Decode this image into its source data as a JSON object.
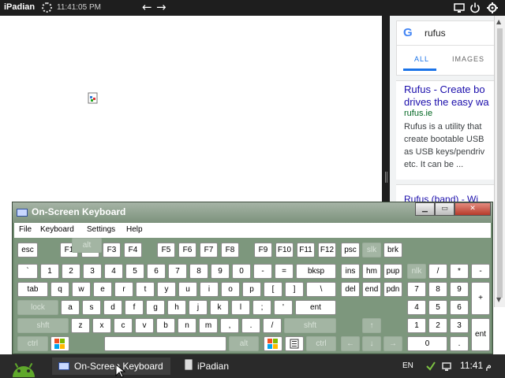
{
  "topbar": {
    "brand": "iPadian",
    "time": "11:41:05 PM",
    "back_glyph": "←",
    "forward_glyph": "→",
    "icons": [
      "monitor-icon",
      "power-icon",
      "settings-icon"
    ]
  },
  "google": {
    "logo": "G",
    "query": "rufus",
    "tabs": [
      "ALL",
      "IMAGES"
    ],
    "result1": {
      "title_line1": "Rufus - Create bo",
      "title_line2": "drives the easy wa",
      "url": "rufus.ie",
      "snippet": [
        "Rufus is a utility that",
        "create bootable USB",
        "as USB keys/pendriv",
        "etc. It can be ..."
      ]
    },
    "result2_title": "Rufus (band) - Wi"
  },
  "osk": {
    "title": "On-Screen Keyboard",
    "window_buttons": [
      "minimize",
      "maximize",
      "close"
    ],
    "menu": [
      "File",
      "Keyboard",
      "Settings",
      "Help"
    ],
    "row1": [
      "esc",
      "F1",
      "F2",
      "F3",
      "F4",
      "F5",
      "F6",
      "F7",
      "F8",
      "F9",
      "F10",
      "F11",
      "F12",
      "psc",
      "slk",
      "brk"
    ],
    "row2": [
      "`",
      "1",
      "2",
      "3",
      "4",
      "5",
      "6",
      "7",
      "8",
      "9",
      "0",
      "-",
      "=",
      "bksp",
      "ins",
      "hm",
      "pup",
      "nlk",
      "/",
      "*",
      "-"
    ],
    "row3": [
      "tab",
      "q",
      "w",
      "e",
      "r",
      "t",
      "y",
      "u",
      "i",
      "o",
      "p",
      "[",
      "]",
      "\\",
      "del",
      "end",
      "pdn",
      "7",
      "8",
      "9",
      "+"
    ],
    "row4": [
      "lock",
      "a",
      "s",
      "d",
      "f",
      "g",
      "h",
      "j",
      "k",
      "l",
      ";",
      "'",
      "ent",
      "4",
      "5",
      "6"
    ],
    "row5": [
      "shft",
      "z",
      "x",
      "c",
      "v",
      "b",
      "n",
      "m",
      ",",
      ".",
      "/",
      "shft",
      "↑",
      "1",
      "2",
      "3",
      "ent"
    ],
    "row6": [
      "ctrl",
      "alt",
      "alt",
      "ctrl",
      "←",
      "↓",
      "→",
      "0",
      "."
    ]
  },
  "taskbar": {
    "tasks": [
      "On-Screen Keyboard",
      "iPadian"
    ],
    "lang": "EN",
    "time": "11:41 م"
  },
  "colors": {
    "keyboard_bg": "#7d977d",
    "link_blue": "#1a0dab",
    "google_blue": "#1a73e8"
  }
}
